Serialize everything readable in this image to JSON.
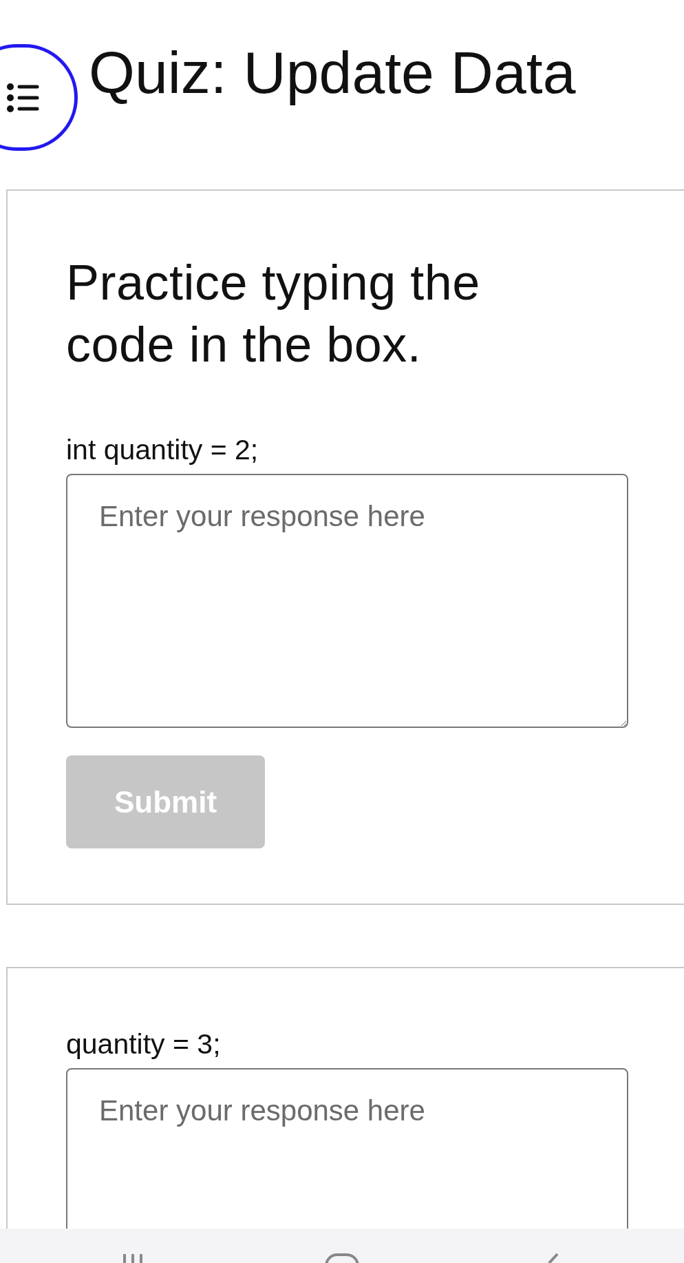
{
  "header": {
    "title": "Quiz: Update Data"
  },
  "cards": [
    {
      "heading": "Practice typing the code in the box.",
      "prompt": "int quantity = 2;",
      "answer": {
        "placeholder": "Enter your response here"
      },
      "submit": {
        "label": "Submit",
        "disabled": true
      }
    },
    {
      "prompt": "quantity = 3;",
      "answer": {
        "placeholder": "Enter your response here"
      }
    }
  ]
}
